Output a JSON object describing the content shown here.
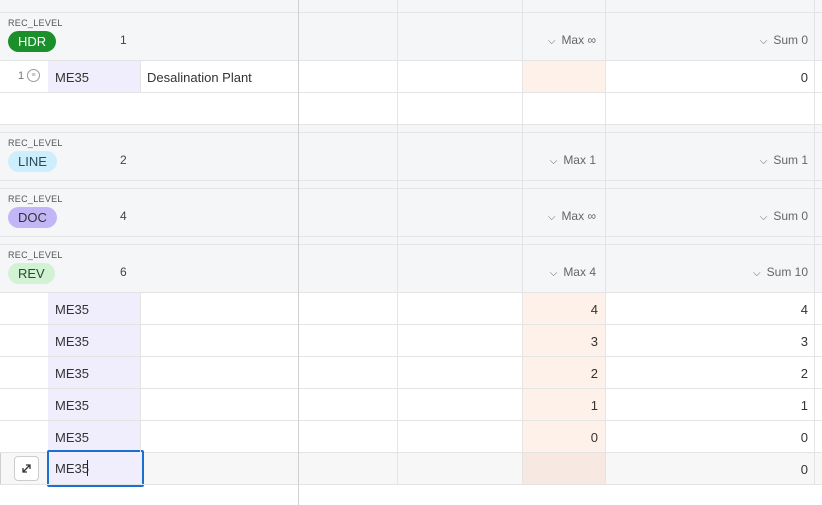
{
  "groups": [
    {
      "level_label": "REC_LEVEL",
      "tag": "HDR",
      "tag_bg": "#1a8f2a",
      "tag_fg": "#ffffff",
      "count": "1",
      "max": "Max ∞",
      "sum": "Sum 0"
    },
    {
      "level_label": "REC_LEVEL",
      "tag": "LINE",
      "tag_bg": "#cdeefd",
      "tag_fg": "#2a4a5a",
      "count": "2",
      "max": "Max 1",
      "sum": "Sum 1"
    },
    {
      "level_label": "REC_LEVEL",
      "tag": "DOC",
      "tag_bg": "#c3b6f7",
      "tag_fg": "#333333",
      "count": "4",
      "max": "Max ∞",
      "sum": "Sum 0"
    },
    {
      "level_label": "REC_LEVEL",
      "tag": "REV",
      "tag_bg": "#d2f3d3",
      "tag_fg": "#2a4a2a",
      "count": "6",
      "max": "Max 4",
      "sum": "Sum 10"
    }
  ],
  "hdr_row": {
    "row_number": "1",
    "id": "ME35",
    "description": "Desalination Plant",
    "sum": "0"
  },
  "rev_rows": [
    {
      "id": "ME35",
      "max": "4",
      "sum": "4"
    },
    {
      "id": "ME35",
      "max": "3",
      "sum": "3"
    },
    {
      "id": "ME35",
      "max": "2",
      "sum": "2"
    },
    {
      "id": "ME35",
      "max": "1",
      "sum": "1"
    },
    {
      "id": "ME35",
      "max": "0",
      "sum": "0"
    }
  ],
  "editing_row": {
    "id": "ME35",
    "sum": "0"
  },
  "colors": {
    "max_cell_bg": "#fdf1ea",
    "id_cell_bg": "#f0eefc",
    "focus_border": "#1a6fd1",
    "group_bg": "#f5f6f8"
  }
}
